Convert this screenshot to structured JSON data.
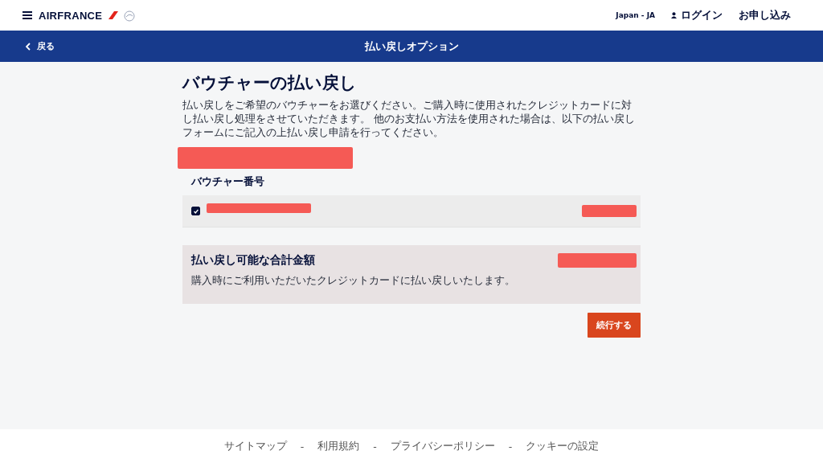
{
  "header": {
    "logo": "AIRFRANCE",
    "locale": "Japan - JA",
    "login": "ログイン",
    "book": "お申し込み"
  },
  "nav_bar": {
    "back": "戻る",
    "title": "払い戻しオプション"
  },
  "page": {
    "title": "バウチャーの払い戻し",
    "description": "払い戻しをご希望のバウチャーをお選びください。ご購入時に使用されたクレジットカードに対し払い戻し処理をさせていただきます。 他のお支払い方法を使用された場合は、以下の払い戻しフォームにご記入の上払い戻し申請を行ってください。"
  },
  "vouchers": {
    "column_header": "バウチャー番号",
    "rows": [
      {
        "checked": true
      }
    ]
  },
  "total": {
    "title": "払い戻し可能な合計金額",
    "note": "購入時にご利用いただいたクレジットカードに払い戻しいたします。"
  },
  "continue_button": "続行する",
  "footer": {
    "links": [
      "サイトマップ",
      "利用規約",
      "プライバシーポリシー",
      "クッキーの設定"
    ],
    "separator": "-"
  }
}
